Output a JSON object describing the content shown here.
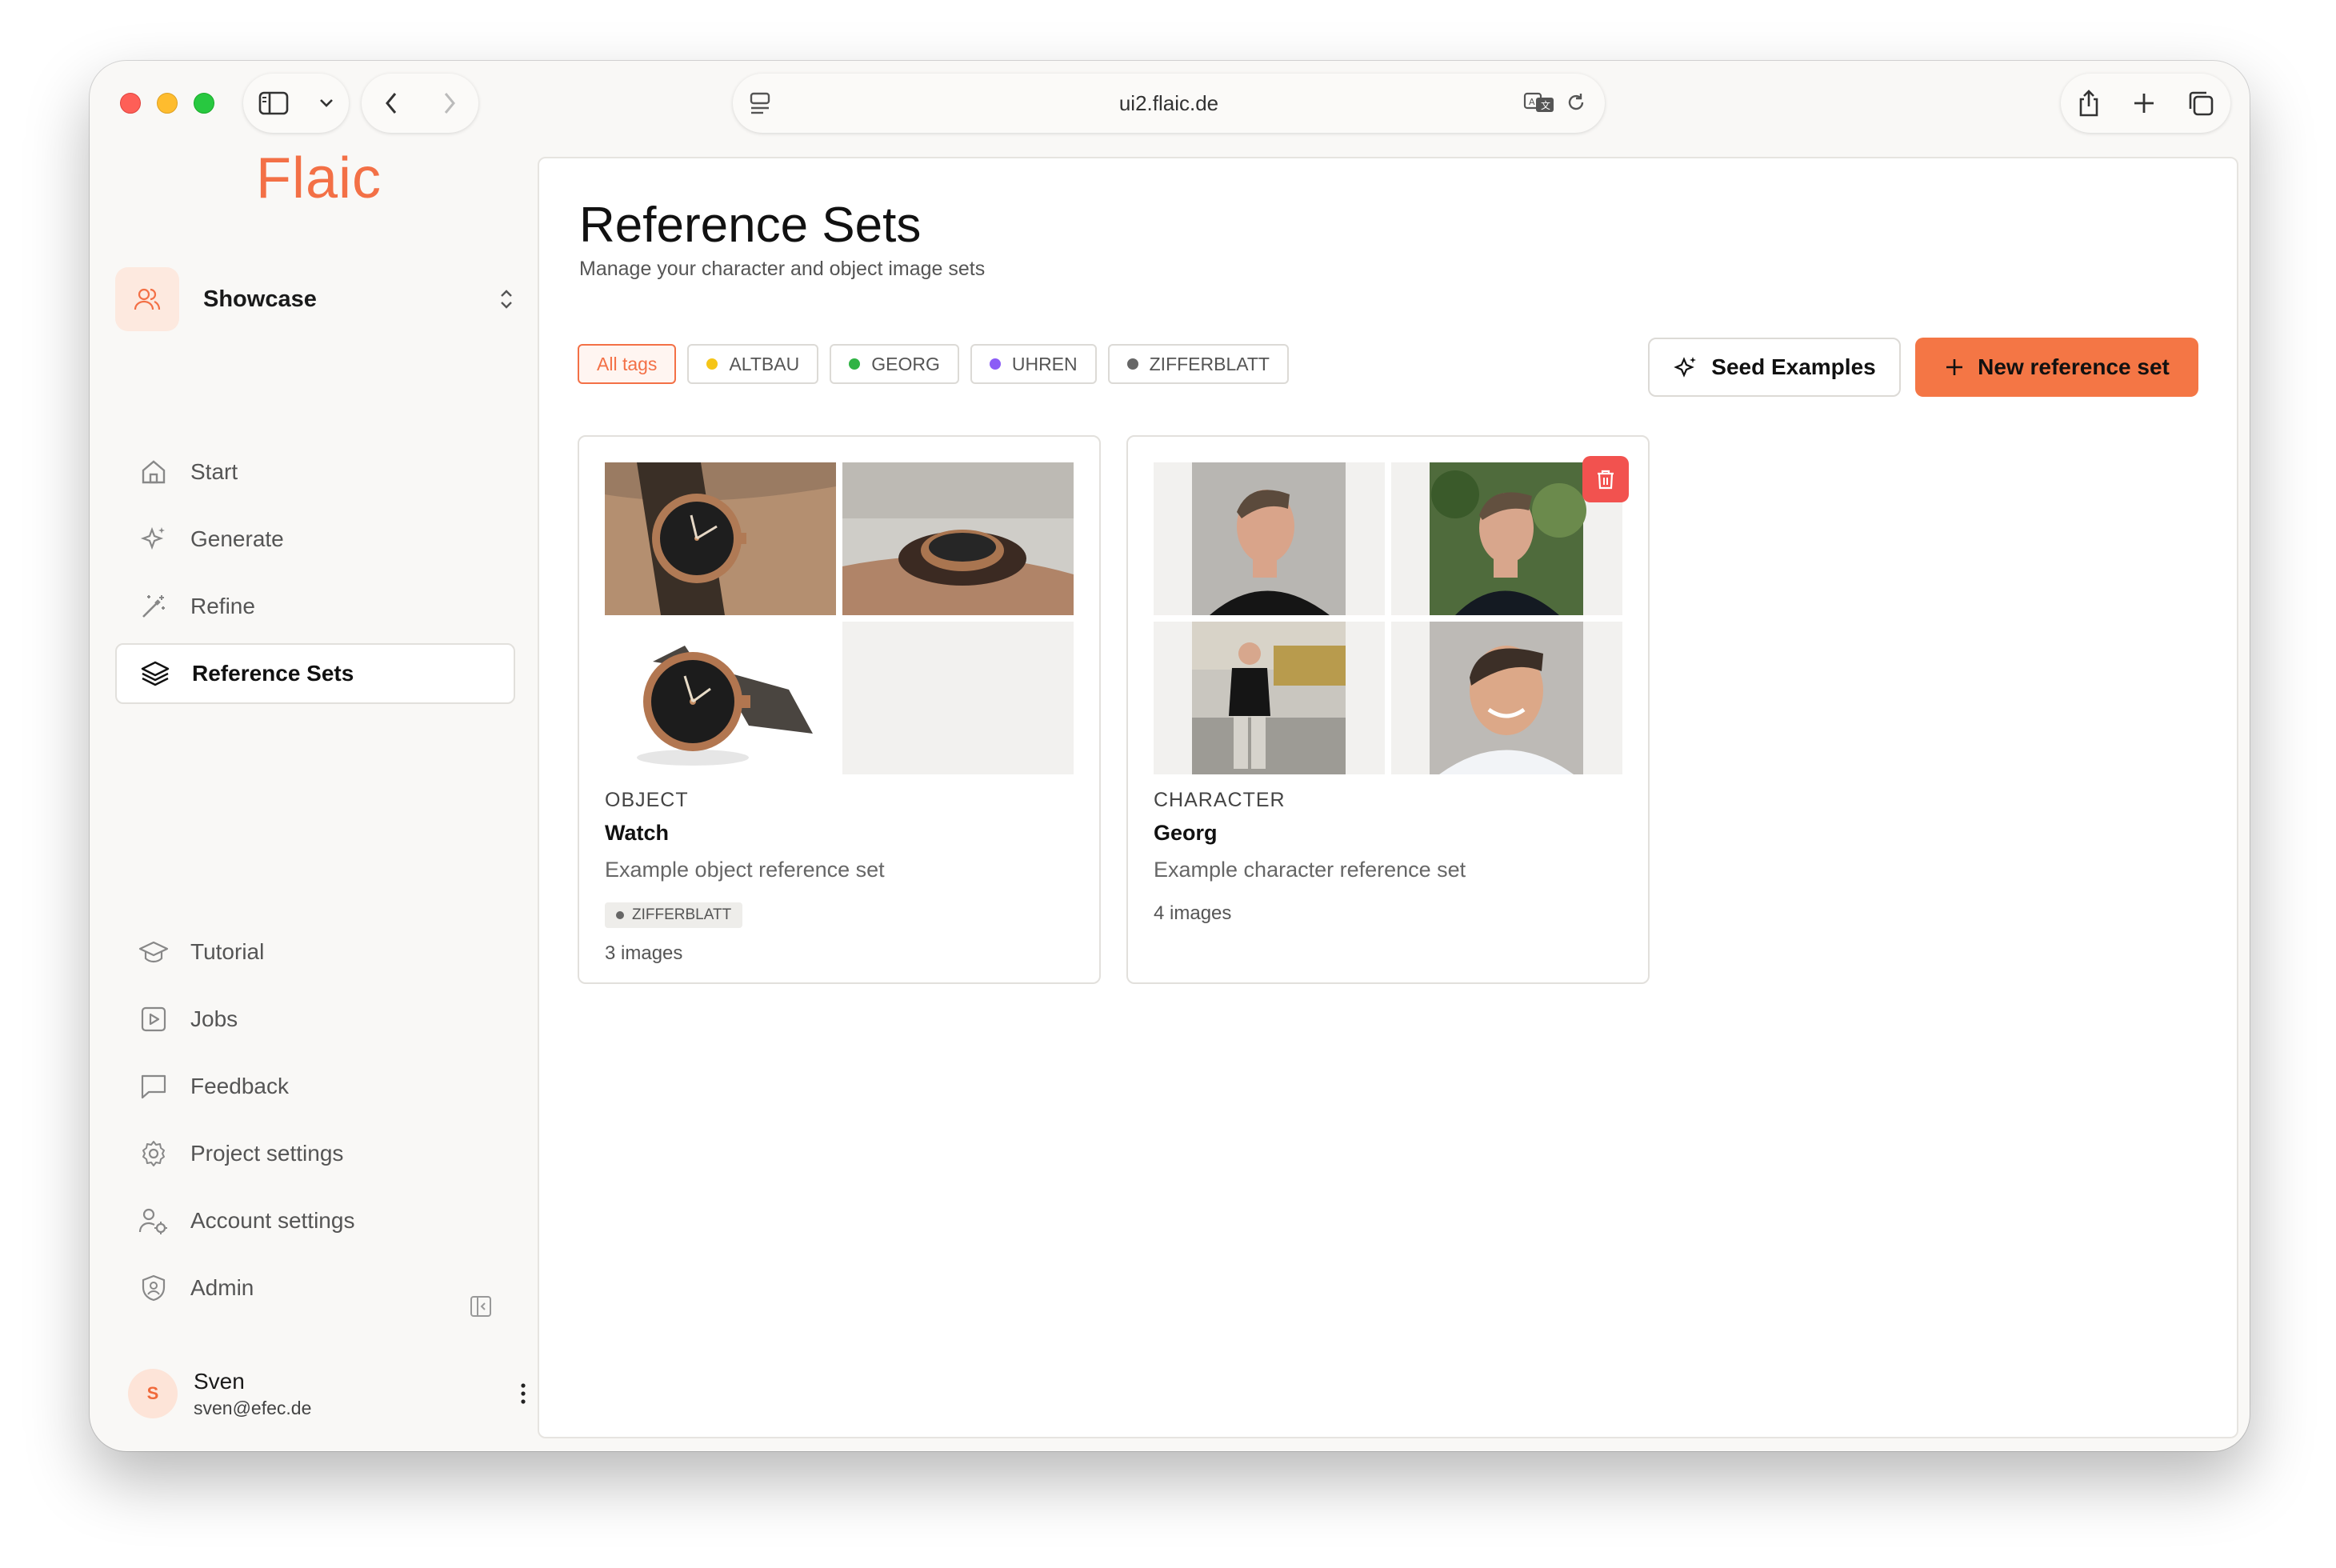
{
  "browser": {
    "url": "ui2.flaic.de"
  },
  "sidebar": {
    "logo": "Flaic",
    "workspace": "Showcase",
    "nav_top": [
      {
        "label": "Start",
        "icon": "home-icon"
      },
      {
        "label": "Generate",
        "icon": "sparkles-icon"
      },
      {
        "label": "Refine",
        "icon": "magic-wand-icon"
      },
      {
        "label": "Reference Sets",
        "icon": "layers-icon",
        "active": true
      }
    ],
    "nav_bottom": [
      {
        "label": "Tutorial",
        "icon": "graduation-cap-icon"
      },
      {
        "label": "Jobs",
        "icon": "play-square-icon"
      },
      {
        "label": "Feedback",
        "icon": "message-square-icon"
      },
      {
        "label": "Project settings",
        "icon": "gear-icon"
      },
      {
        "label": "Account settings",
        "icon": "user-gear-icon"
      },
      {
        "label": "Admin",
        "icon": "shield-user-icon"
      }
    ],
    "user": {
      "initial": "S",
      "name": "Sven",
      "email": "sven@efec.de"
    }
  },
  "main": {
    "title": "Reference Sets",
    "subtitle": "Manage your character and object image sets",
    "tags": [
      {
        "label": "All tags",
        "color": "",
        "active": true
      },
      {
        "label": "ALTBAU",
        "color": "#f5c518"
      },
      {
        "label": "GEORG",
        "color": "#2fb344"
      },
      {
        "label": "UHREN",
        "color": "#8b5cf6"
      },
      {
        "label": "ZIFFERBLATT",
        "color": "#666666"
      }
    ],
    "seed_button": "Seed Examples",
    "new_button": "New reference set",
    "accent": "#f47645",
    "cards": [
      {
        "type": "OBJECT",
        "name": "Watch",
        "description": "Example object reference set",
        "tag": "ZIFFERBLATT",
        "count": "3 images"
      },
      {
        "type": "CHARACTER",
        "name": "Georg",
        "description": "Example character reference set",
        "count": "4 images"
      }
    ]
  }
}
